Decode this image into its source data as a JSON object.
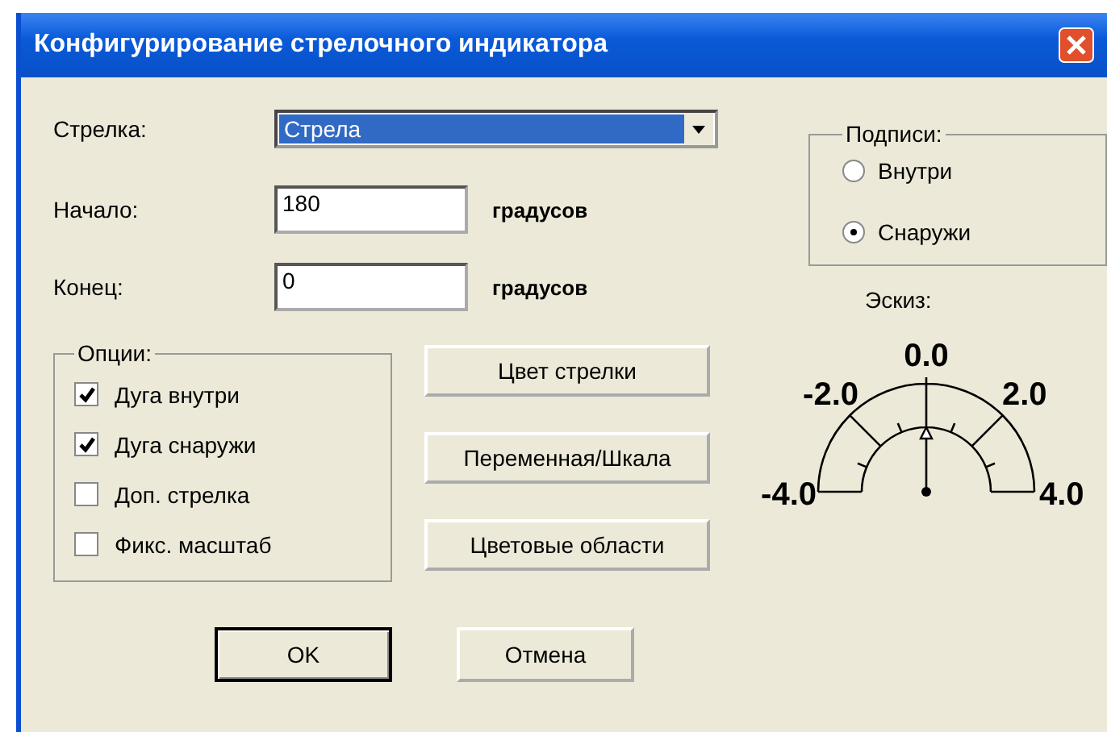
{
  "window": {
    "title": "Конфигурирование стрелочного индикатора"
  },
  "fields": [
    {
      "label": "Стрелка:",
      "kind": "dropdown",
      "value": "Стрела"
    },
    {
      "label": "Начало:",
      "kind": "number",
      "value": "180",
      "unit": "градусов"
    },
    {
      "label": "Конец:",
      "kind": "number",
      "value": "0",
      "unit": "градусов"
    }
  ],
  "options_group": {
    "title": "Опции:",
    "items": [
      {
        "label": "Дуга внутри",
        "checked": true
      },
      {
        "label": "Дуга снаружи",
        "checked": true
      },
      {
        "label": "Доп. стрелка",
        "checked": false
      },
      {
        "label": "Фикс. масштаб",
        "checked": false
      }
    ]
  },
  "action_buttons": [
    "Цвет стрелки",
    "Переменная/Шкала",
    "Цветовые области"
  ],
  "dialog_buttons": [
    {
      "label": "OK",
      "default": true
    },
    {
      "label": "Отмена",
      "default": false
    }
  ],
  "labels_group": {
    "title": "Подписи:",
    "options": [
      {
        "label": "Внутри",
        "selected": false
      },
      {
        "label": "Снаружи",
        "selected": true
      }
    ]
  },
  "preview": {
    "title": "Эскиз:",
    "scale_labels": [
      "-4.0",
      "-2.0",
      "0.0",
      "2.0",
      "4.0"
    ]
  }
}
